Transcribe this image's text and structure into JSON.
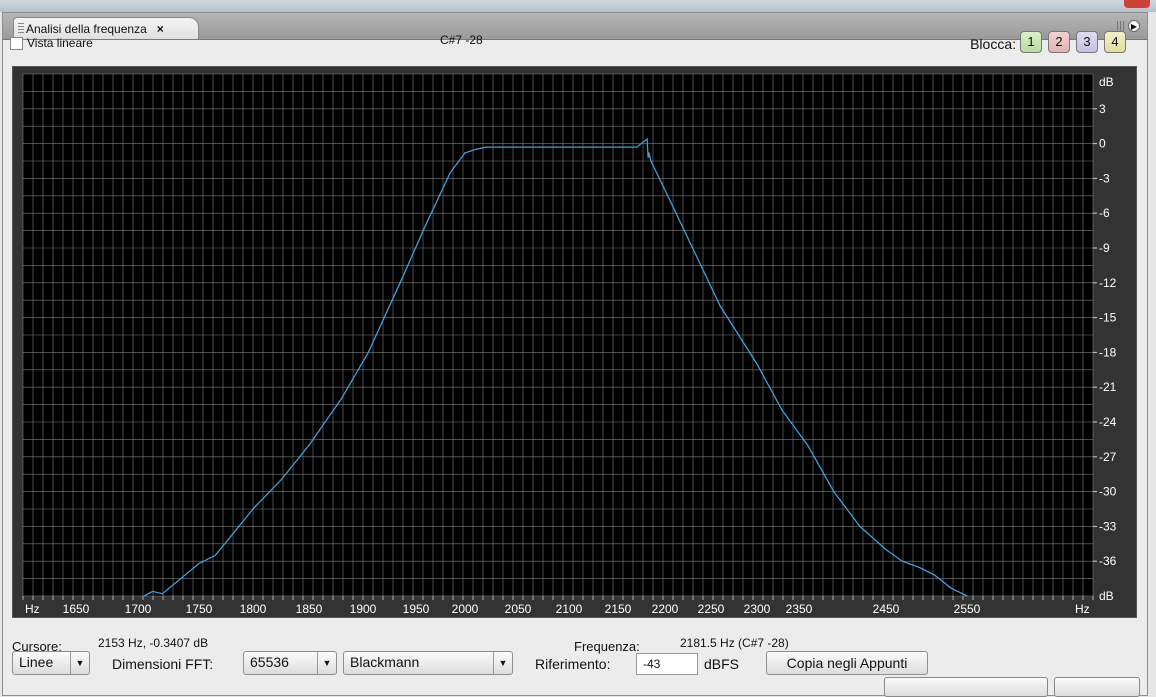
{
  "panel": {
    "tab_title": "Analisi della frequenza",
    "tab_close": "×"
  },
  "toolbar": {
    "linear_view_label": "Vista lineare",
    "linear_view_checked": false,
    "note_readout": "C#7 -28",
    "lock_label": "Blocca:",
    "lock_buttons": [
      "1",
      "2",
      "3",
      "4"
    ]
  },
  "graph": {
    "x_unit": "Hz",
    "y_unit": "dB",
    "x_ticks": [
      {
        "label": "1650",
        "value": 1650
      },
      {
        "label": "1700",
        "value": 1700
      },
      {
        "label": "1750",
        "value": 1750
      },
      {
        "label": "1800",
        "value": 1800
      },
      {
        "label": "1850",
        "value": 1850
      },
      {
        "label": "1900",
        "value": 1900
      },
      {
        "label": "1950",
        "value": 1950
      },
      {
        "label": "2000",
        "value": 2000
      },
      {
        "label": "2050",
        "value": 2050
      },
      {
        "label": "2100",
        "value": 2100
      },
      {
        "label": "2150",
        "value": 2150
      },
      {
        "label": "2200",
        "value": 2200
      },
      {
        "label": "2250",
        "value": 2250
      },
      {
        "label": "2300",
        "value": 2300
      },
      {
        "label": "2350",
        "value": 2350
      },
      {
        "label": "2450",
        "value": 2450
      },
      {
        "label": "2550",
        "value": 2550
      }
    ],
    "y_ticks": [
      "3",
      "0",
      "-3",
      "-6",
      "-9",
      "-12",
      "-15",
      "-18",
      "-21",
      "-24",
      "-27",
      "-30",
      "-33",
      "-36"
    ],
    "y_values": [
      3,
      0,
      -3,
      -6,
      -9,
      -12,
      -15,
      -18,
      -21,
      -24,
      -27,
      -30,
      -33,
      -36
    ],
    "ylim": [
      -39,
      6
    ],
    "xlim": [
      1620,
      2700
    ],
    "curve_color": "#3fa0dc",
    "background_color": "#000000",
    "grid_color": "#8a8a8a"
  },
  "chart_data": {
    "type": "line",
    "xlabel": "Hz",
    "ylabel": "dB",
    "xlim": [
      1620,
      2700
    ],
    "ylim": [
      -39,
      6
    ],
    "grid": true,
    "x": [
      1705,
      1712,
      1720,
      1735,
      1750,
      1765,
      1780,
      1800,
      1825,
      1850,
      1880,
      1905,
      1935,
      1960,
      1985,
      2000,
      2010,
      2020,
      2100,
      2170,
      2181,
      2182,
      2183,
      2185,
      2200,
      2230,
      2260,
      2300,
      2330,
      2360,
      2390,
      2420,
      2450,
      2470,
      2490,
      2510,
      2530,
      2550
    ],
    "y": [
      -39,
      -38.6,
      -38.8,
      -37.5,
      -36.2,
      -35.5,
      -33.8,
      -31.5,
      -29,
      -26,
      -22,
      -18,
      -12,
      -7,
      -2.5,
      -0.8,
      -0.5,
      -0.3,
      -0.3,
      -0.3,
      0.4,
      -1.2,
      -0.8,
      -1.5,
      -4,
      -9,
      -14,
      -19,
      -23,
      -26,
      -30,
      -33,
      -35,
      -36,
      -36.5,
      -37.2,
      -38.3,
      -39
    ]
  },
  "status": {
    "cursor_label": "Cursore:",
    "cursor_value": "2153 Hz, -0.3407 dB",
    "frequency_label": "Frequenza:",
    "frequency_value": "2181.5 Hz (C#7 -28)"
  },
  "controls": {
    "display_mode": "Linee",
    "fft_label": "Dimensioni FFT:",
    "fft_size": "65536",
    "window_type": "Blackmann",
    "reference_label": "Riferimento:",
    "reference_value": "-43",
    "reference_unit": "dBFS",
    "copy_button": "Copia negli Appunti"
  }
}
